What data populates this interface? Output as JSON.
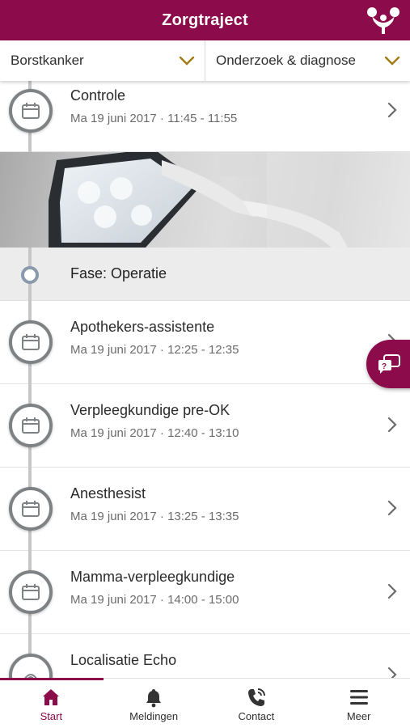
{
  "header": {
    "title": "Zorgtraject"
  },
  "filters": [
    {
      "label": "Borstkanker"
    },
    {
      "label": "Onderzoek & diagnose"
    }
  ],
  "rows_top": [
    {
      "title": "Controle",
      "date": "Ma 19 juni 2017 · 11:45 - 11:55",
      "icon": "calendar-icon"
    }
  ],
  "phase": {
    "title": "Fase: Operatie"
  },
  "rows": [
    {
      "title": "Apothekers-assistente",
      "date": "Ma 19 juni 2017 · 12:25 - 12:35",
      "icon": "calendar-icon"
    },
    {
      "title": "Verpleegkundige pre-OK",
      "date": "Ma 19 juni 2017 · 12:40 - 13:10",
      "icon": "calendar-icon"
    },
    {
      "title": "Anesthesist",
      "date": "Ma 19 juni 2017 · 13:25 - 13:35",
      "icon": "calendar-icon"
    },
    {
      "title": "Mamma-verpleegkundige",
      "date": "Ma 19 juni 2017 · 14:00 - 15:00",
      "icon": "calendar-icon"
    },
    {
      "title": "Localisatie Echo",
      "date": "",
      "icon": "ultrasound-icon"
    }
  ],
  "tabs": [
    {
      "label": "Start",
      "icon": "home-icon",
      "active": true
    },
    {
      "label": "Meldingen",
      "icon": "bell-icon",
      "active": false
    },
    {
      "label": "Contact",
      "icon": "phone-icon",
      "active": false
    },
    {
      "label": "Meer",
      "icon": "menu-icon",
      "active": false
    }
  ],
  "colors": {
    "brand": "#8c0b4a",
    "timeline": "#7e8285",
    "phase_bg": "#ececec"
  }
}
